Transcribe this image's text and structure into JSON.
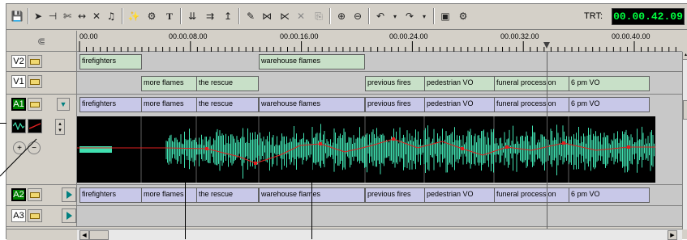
{
  "toolbar": {
    "icons": [
      "save-icon",
      "pointer-icon",
      "trim-icon",
      "razor-icon",
      "ripple-icon",
      "delete-icon",
      "audio-mixer-icon",
      "effects-icon",
      "transition-icon",
      "title-icon",
      "splice-in-icon",
      "overwrite-icon",
      "lift-icon",
      "extract-icon",
      "link-icon",
      "unlink-icon",
      "cut-icon",
      "paste-icon",
      "zoom-in-icon",
      "zoom-out-icon",
      "undo-icon",
      "redo-icon",
      "settings-icon",
      "snap-icon"
    ],
    "trt_label": "TRT:",
    "trt_value": "00.00.42.09"
  },
  "ruler": {
    "labels": [
      "00.00",
      "00.00.08.00",
      "00.00.16.00",
      "00.00.24.00",
      "00.00.32.00",
      "00.00.40.00"
    ]
  },
  "tracks": {
    "v2": {
      "name": "V2",
      "clips": [
        {
          "label": "firefighters"
        },
        {
          "label": "warehouse flames"
        }
      ]
    },
    "v1": {
      "name": "V1",
      "clips": [
        {
          "label": "more flames"
        },
        {
          "label": "the rescue"
        },
        {
          "label": "previous fires"
        },
        {
          "label": "pedestrian VO"
        },
        {
          "label": "funeral procession"
        },
        {
          "label": "6 pm VO"
        }
      ]
    },
    "a1": {
      "name": "A1",
      "clips": [
        {
          "label": "firefighters"
        },
        {
          "label": "more flames"
        },
        {
          "label": "the rescue"
        },
        {
          "label": "warehouse flames"
        },
        {
          "label": "previous fires"
        },
        {
          "label": "pedestrian VO"
        },
        {
          "label": "funeral procession"
        },
        {
          "label": "6 pm VO"
        }
      ]
    },
    "a2": {
      "name": "A2",
      "clips": [
        {
          "label": "firefighters"
        },
        {
          "label": "more flames"
        },
        {
          "label": "the rescue"
        },
        {
          "label": "warehouse flames"
        },
        {
          "label": "previous fires"
        },
        {
          "label": "pedestrian VO"
        },
        {
          "label": "funeral procession"
        },
        {
          "label": "6 pm VO"
        }
      ]
    },
    "a3": {
      "name": "A3"
    }
  },
  "colors": {
    "trt_text": "#00ff40",
    "waveform": "#40e0b0",
    "rubberband": "#e02020",
    "video_clip": "#c8e0c8",
    "audio_clip": "#c8c8e8"
  }
}
